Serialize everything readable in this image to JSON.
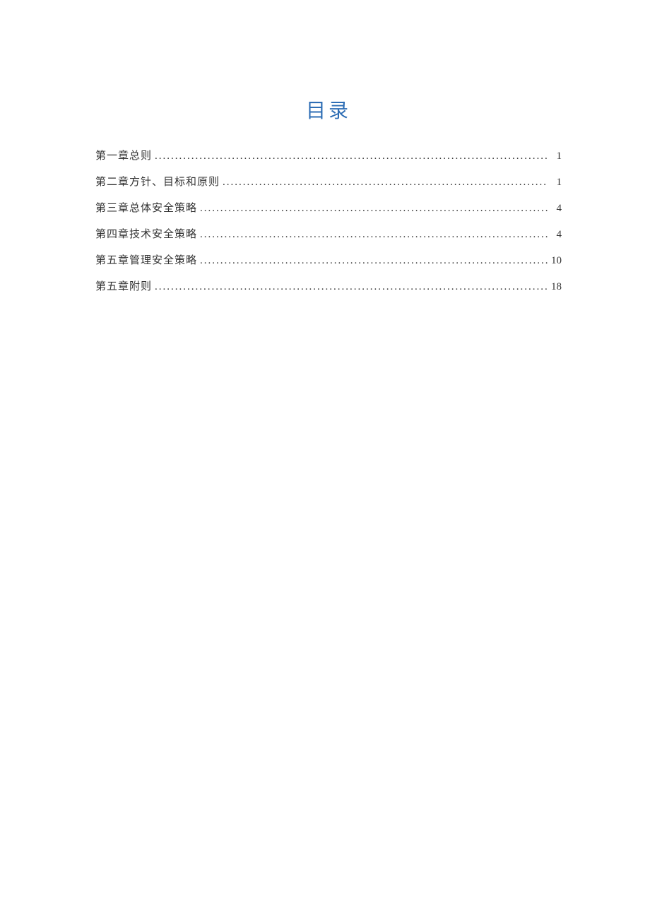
{
  "title": "目录",
  "toc": [
    {
      "label": "第一章总则",
      "page": "1"
    },
    {
      "label": "第二章方针、目标和原则",
      "page": "1"
    },
    {
      "label": "第三章总体安全策略",
      "page": "4"
    },
    {
      "label": "第四章技术安全策略",
      "page": "4"
    },
    {
      "label": "第五章管理安全策略",
      "page": "10"
    },
    {
      "label": "第五章附则",
      "page": "18"
    }
  ]
}
